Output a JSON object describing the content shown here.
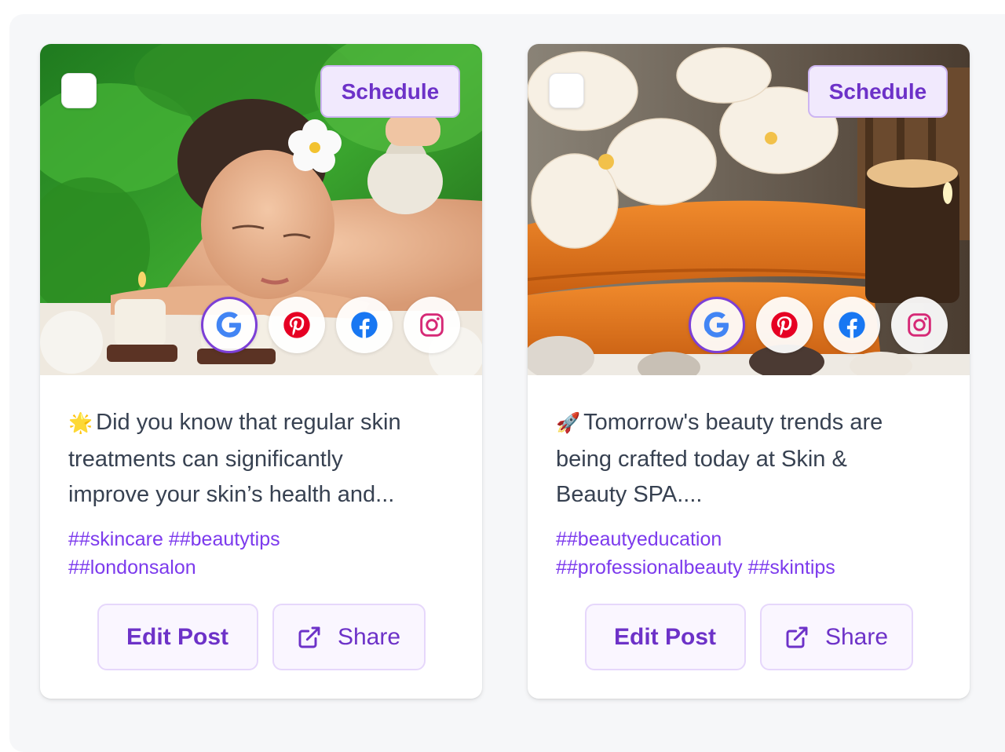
{
  "colors": {
    "accent": "#7c3aed",
    "schedule_bg": "#f1e9fd",
    "google_blue": "#4285f4",
    "pinterest_red": "#e60023",
    "facebook_blue": "#1877f2",
    "instagram_pink": "#d62976"
  },
  "posts": [
    {
      "schedule_label": "Schedule",
      "image_subject": "spa massage woman with herbal compress",
      "networks": [
        "google-icon",
        "pinterest-icon",
        "facebook-icon",
        "instagram-icon"
      ],
      "active_network": "google",
      "caption_emoji": "🌟",
      "caption_line1": "Did you know that regular skin",
      "caption_line2": "treatments can significantly",
      "caption_line3": "improve your skin’s health and...",
      "tags_line1": "##skincare ##beautytips",
      "tags_line2": "##londonsalon",
      "edit_label": "Edit Post",
      "share_label": "Share"
    },
    {
      "schedule_label": "Schedule",
      "image_subject": "orchids, orange towels, candles and spa stones",
      "networks": [
        "google-icon",
        "pinterest-icon",
        "facebook-icon",
        "instagram-icon"
      ],
      "active_network": "google",
      "caption_emoji": "🚀",
      "caption_line1": "Tomorrow's beauty trends are",
      "caption_line2": "being crafted today at Skin &",
      "caption_line3": "Beauty SPA....",
      "tags_line1": "##beautyeducation",
      "tags_line2": "##professionalbeauty ##skintips",
      "edit_label": "Edit Post",
      "share_label": "Share"
    }
  ]
}
